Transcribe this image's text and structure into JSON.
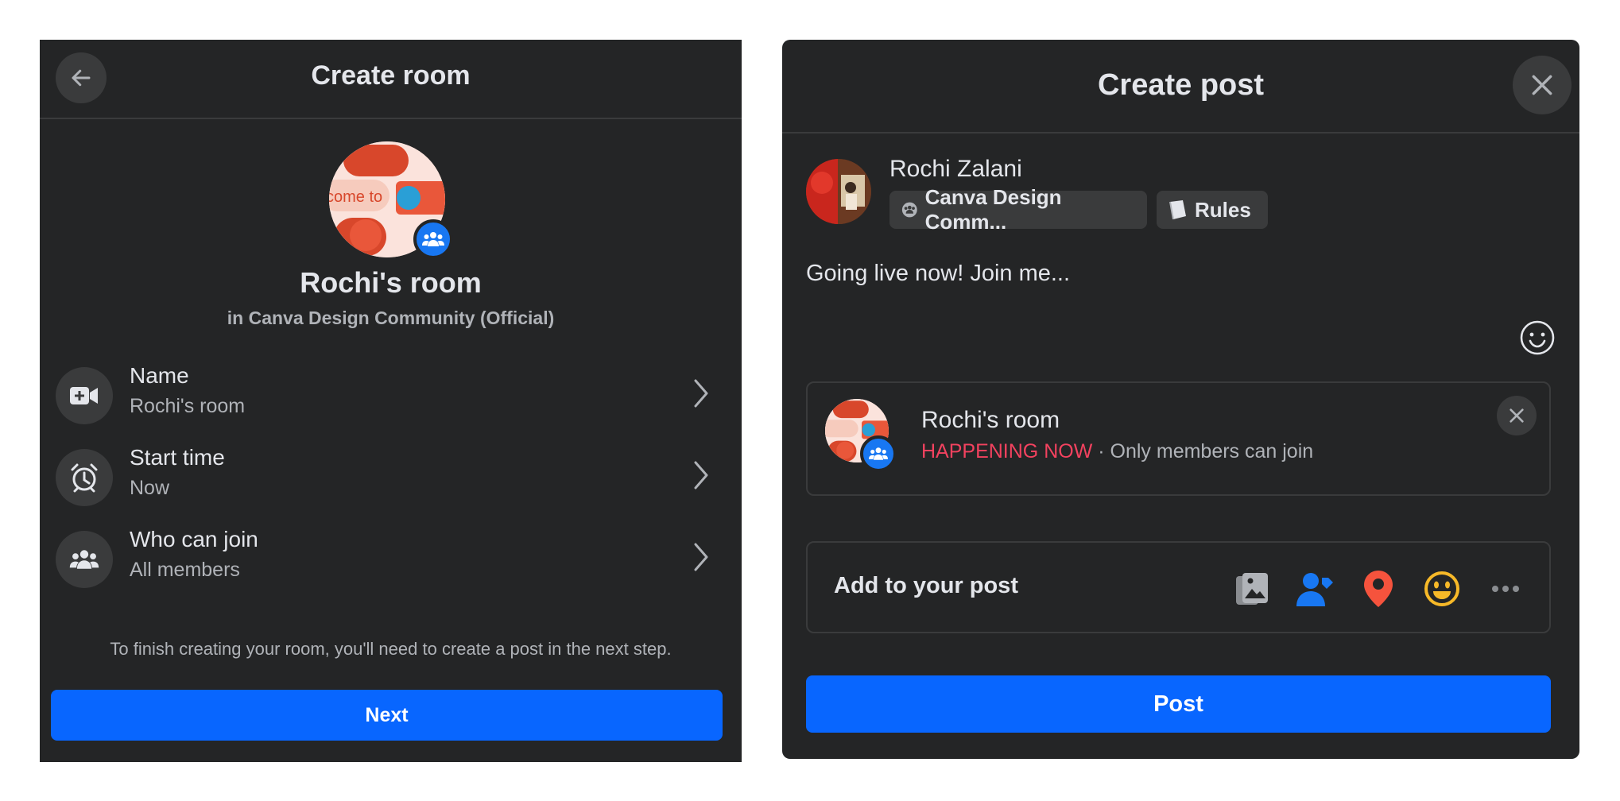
{
  "create_room": {
    "title": "Create room",
    "room_name": "Rochi's room",
    "room_subtitle": "in Canva Design Community (Official)",
    "avatar_text": "come to",
    "options": [
      {
        "label": "Name",
        "value": "Rochi's room",
        "icon": "video-plus-icon"
      },
      {
        "label": "Start time",
        "value": "Now",
        "icon": "alarm-clock-icon"
      },
      {
        "label": "Who can join",
        "value": "All members",
        "icon": "group-icon"
      }
    ],
    "finish_note": "To finish creating your room, you'll need to create a post in the next step.",
    "next_label": "Next"
  },
  "create_post": {
    "title": "Create post",
    "user_name": "Rochi Zalani",
    "group_chip": "Canva Design Comm...",
    "rules_chip": "Rules",
    "post_text": "Going live now! Join me...",
    "room_card": {
      "title": "Rochi's room",
      "status": "HAPPENING NOW",
      "separator": " · ",
      "audience": "Only members can join"
    },
    "add_to_post": "Add to your post",
    "add_icons": [
      "photo-video-icon",
      "tag-people-icon",
      "location-pin-icon",
      "feeling-emoji-icon",
      "more-icon"
    ],
    "post_label": "Post"
  },
  "colors": {
    "panel_bg": "#242526",
    "button_blue": "#0866ff",
    "live_red": "#f3425f",
    "pin_red": "#f5533d",
    "emoji_yellow": "#f7b928"
  }
}
